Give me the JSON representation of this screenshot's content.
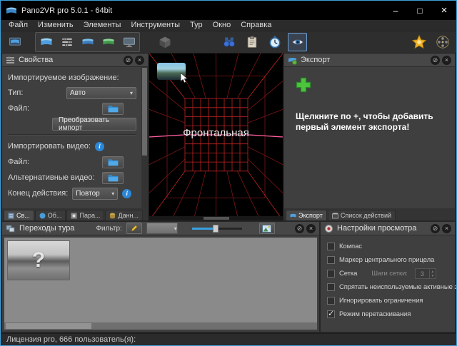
{
  "window": {
    "title": "Pano2VR pro 5.0.1 - 64bit",
    "controls": {
      "minimize": "–",
      "maximize": "□",
      "close": "×"
    }
  },
  "panel_chrome": {
    "detach": "⊘",
    "close": "×"
  },
  "menu": {
    "items": [
      "Файл",
      "Изменить",
      "Элементы",
      "Инструменты",
      "Тур",
      "Окно",
      "Справка"
    ]
  },
  "toolbar": {
    "icons": [
      "input-panorama",
      "viewing-parameters",
      "user-data-sliders",
      "panorama-preview",
      "panorama-output",
      "display",
      "cube-face",
      "find-binoculars",
      "clipboard",
      "timer",
      "viewer-eye",
      "pro-award",
      "film-reel"
    ]
  },
  "properties": {
    "title": "Свойства",
    "imported_image_label": "Импортируемое изображение:",
    "type_label": "Тип:",
    "type_value": "Авто",
    "file_label": "Файл:",
    "convert_button": "Преобразовать импорт",
    "import_video_label": "Импортировать видео:",
    "file2_label": "Файл:",
    "alt_video_label": "Альтернативные видео:",
    "end_action_label": "Конец действия:",
    "end_action_value": "Повтор",
    "tabs": [
      "Св...",
      "Об...",
      "Пара...",
      "Данн..."
    ]
  },
  "viewer": {
    "face_label": "Фронтальная"
  },
  "export": {
    "title": "Экспорт",
    "hint": "Щелкните по +, чтобы добавить первый элемент экспорта!",
    "tabs": [
      "Экспорт",
      "Список действий"
    ]
  },
  "transitions": {
    "title": "Переходы тура",
    "filter_label": "Фильтр:",
    "placeholder_mark": "?"
  },
  "view_settings": {
    "title": "Настройки просмотра",
    "checkboxes": [
      {
        "label": "Компас",
        "checked": false
      },
      {
        "label": "Маркер центрального прицела",
        "checked": false
      },
      {
        "label": "Сетка",
        "checked": false
      },
      {
        "label": "Спрятать неиспользуемые активные зоны",
        "checked": false
      },
      {
        "label": "Игнорировать ограничения",
        "checked": false
      },
      {
        "label": "Режим перетаскивания",
        "checked": true
      }
    ],
    "grid_steps_label": "Шаги сетки:",
    "grid_steps_value": "3"
  },
  "status": {
    "text": "Лицензия pro, 666 пользователь(я):"
  },
  "colors": {
    "accent_green": "#4cc43c",
    "grid_red": "#c02525",
    "equator_pink": "#ff5fa0",
    "window_border": "#3f9fd8",
    "folder_blue": "#2e8fd8"
  }
}
